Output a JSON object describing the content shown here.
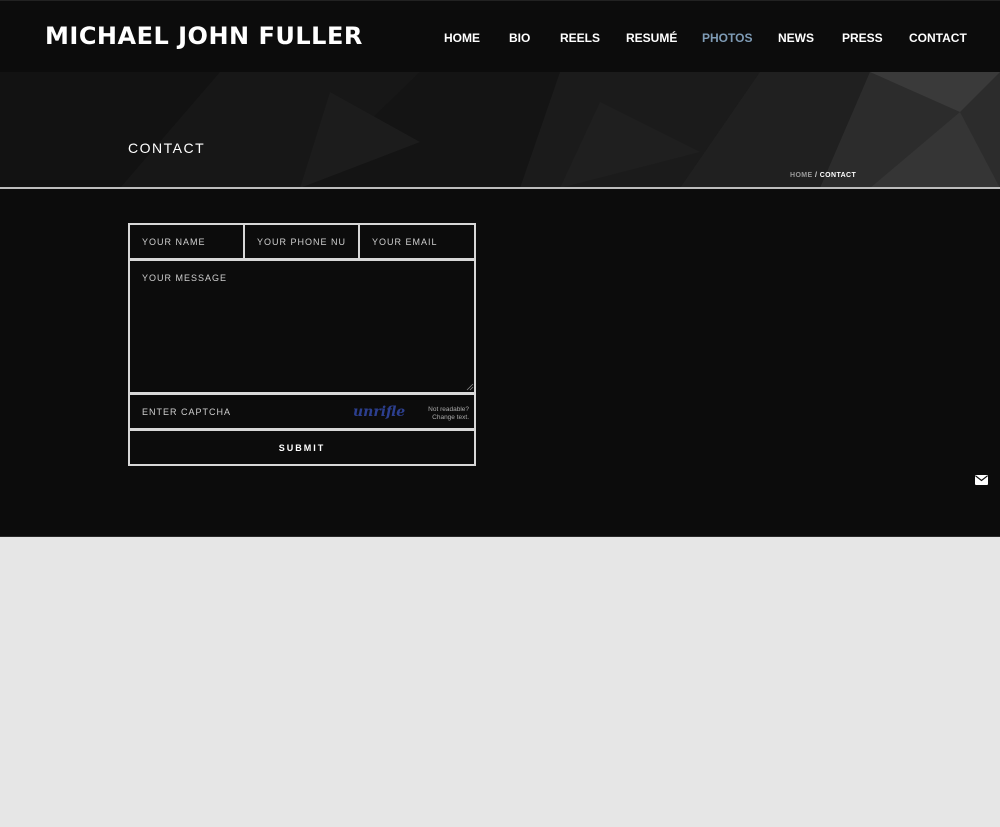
{
  "header": {
    "site_title": "MICHAEL JOHN FULLER",
    "nav": [
      {
        "label": "HOME",
        "active": false
      },
      {
        "label": "BIO",
        "active": false
      },
      {
        "label": "REELS",
        "active": false
      },
      {
        "label": "RESUMÉ",
        "active": false
      },
      {
        "label": "PHOTOS",
        "active": true
      },
      {
        "label": "NEWS",
        "active": false
      },
      {
        "label": "PRESS",
        "active": false
      },
      {
        "label": "CONTACT",
        "active": false
      }
    ]
  },
  "banner": {
    "title": "CONTACT",
    "breadcrumb": {
      "home": "HOME",
      "separator": "/",
      "current": "CONTACT"
    }
  },
  "form": {
    "name_placeholder": "YOUR NAME",
    "phone_placeholder": "YOUR PHONE NUMBER",
    "email_placeholder": "YOUR EMAIL",
    "message_placeholder": "YOUR MESSAGE",
    "captcha_placeholder": "ENTER CAPTCHA",
    "captcha_image_text": "unrifled",
    "captcha_change_text": "Not readable? Change text.",
    "submit_label": "SUBMIT"
  },
  "floating_button": {
    "icon": "envelope-icon"
  },
  "colors": {
    "active_nav": "#7e9bb5",
    "background_dark": "#0c0c0c",
    "page_background": "#e6e6e6"
  }
}
